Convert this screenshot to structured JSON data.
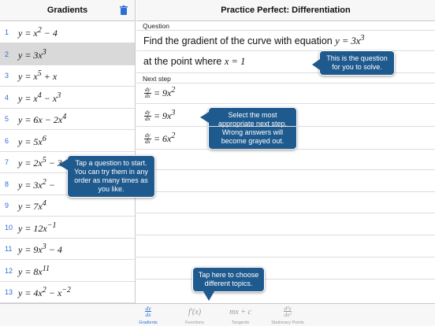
{
  "sidebar": {
    "title": "Gradients",
    "questions": [
      {
        "num": "1",
        "html": "y = x<sup>2</sup> − 4"
      },
      {
        "num": "2",
        "html": "y = 3x<sup>3</sup>"
      },
      {
        "num": "3",
        "html": "y = x<sup>5</sup> + x"
      },
      {
        "num": "4",
        "html": "y = x<sup>4</sup> − x<sup>3</sup>"
      },
      {
        "num": "5",
        "html": "y = 6x − 2x<sup>4</sup>"
      },
      {
        "num": "6",
        "html": "y = 5x<sup>6</sup>"
      },
      {
        "num": "7",
        "html": "y = 2x<sup>5</sup> − 3"
      },
      {
        "num": "8",
        "html": "y = 3x<sup>2</sup> −"
      },
      {
        "num": "9",
        "html": "y = 7x<sup>4</sup>"
      },
      {
        "num": "10",
        "html": "y = 12x<sup>−1</sup>"
      },
      {
        "num": "11",
        "html": "y = 9x<sup>3</sup> − 4"
      },
      {
        "num": "12",
        "html": "y = 8x<sup>11</sup>"
      },
      {
        "num": "13",
        "html": "y = 4x<sup>2</sup> − x<sup>−2</sup>"
      }
    ],
    "selected_index": 1
  },
  "main": {
    "title": "Practice Perfect: Differentiation",
    "question_label": "Question",
    "question_text": "Find the gradient of the curve with equation",
    "question_eq": "y = 3x<sup>3</sup>",
    "point_text": "at the point where",
    "point_eq": "x = 1",
    "next_step_label": "Next step",
    "steps": [
      "= 9x<sup>2</sup>",
      "= 9x<sup>3</sup>",
      "= 6x<sup>2</sup>"
    ],
    "dy": "dy",
    "dx": "dx"
  },
  "tips": {
    "question": "This is the question for you to solve.",
    "next_step": "Select the most appropriate next step. Wrong answers will become grayed out.",
    "start": "Tap a question to start. You can try them in any order as many times as you like.",
    "topics": "Tap here to choose different topics."
  },
  "tabs": [
    {
      "label": "Gradients",
      "icon": "dy/dx"
    },
    {
      "label": "Functions",
      "icon": "f′(x)"
    },
    {
      "label": "Tangents",
      "icon": "mx + c"
    },
    {
      "label": "Stationary Points",
      "icon": "d²y/dx²"
    }
  ],
  "colors": {
    "accent": "#2b6fd6",
    "tooltip": "#1e5a8e",
    "selected_row": "#d9d9d9"
  }
}
